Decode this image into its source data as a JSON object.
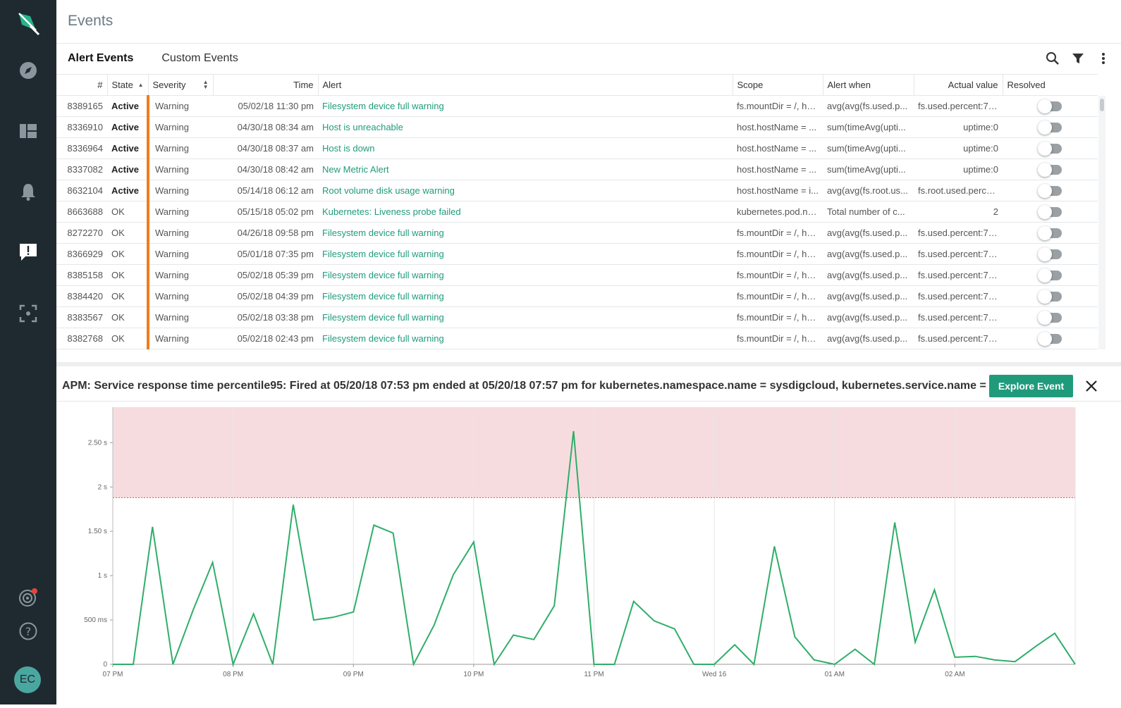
{
  "app": {
    "page_title": "Events"
  },
  "sidebar": {
    "icons": [
      "logo-icon",
      "explore-icon",
      "dashboards-icon",
      "alerts-icon",
      "events-icon",
      "capture-icon",
      "spotlight-icon",
      "help-icon"
    ],
    "avatar_initials": "EC"
  },
  "tabs": [
    {
      "label": "Alert Events"
    },
    {
      "label": "Custom Events"
    }
  ],
  "table": {
    "headers": [
      "#",
      "State",
      "Severity",
      "Time",
      "Alert",
      "Scope",
      "Alert when",
      "Actual value",
      "Resolved"
    ],
    "rows": [
      {
        "id": "8389165",
        "state": "Active",
        "severity": "Warning",
        "time": "05/02/18 11:30 pm",
        "alert": "Filesystem device full warning",
        "scope": "fs.mountDir = /, ho...",
        "alert_when": "avg(avg(fs.used.p...",
        "actual_value": "fs.used.percent:75..."
      },
      {
        "id": "8336910",
        "state": "Active",
        "severity": "Warning",
        "time": "04/30/18 08:34 am",
        "alert": "Host is unreachable",
        "scope": "host.hostName = ...",
        "alert_when": "sum(timeAvg(upti...",
        "actual_value": "uptime:0"
      },
      {
        "id": "8336964",
        "state": "Active",
        "severity": "Warning",
        "time": "04/30/18 08:37 am",
        "alert": "Host is down",
        "scope": "host.hostName = ...",
        "alert_when": "sum(timeAvg(upti...",
        "actual_value": "uptime:0"
      },
      {
        "id": "8337082",
        "state": "Active",
        "severity": "Warning",
        "time": "04/30/18 08:42 am",
        "alert": "New Metric Alert",
        "scope": "host.hostName = ...",
        "alert_when": "sum(timeAvg(upti...",
        "actual_value": "uptime:0"
      },
      {
        "id": "8632104",
        "state": "Active",
        "severity": "Warning",
        "time": "05/14/18 06:12 am",
        "alert": "Root volume disk usage warning",
        "scope": "host.hostName = i...",
        "alert_when": "avg(avg(fs.root.us...",
        "actual_value": "fs.root.used.perce..."
      },
      {
        "id": "8663688",
        "state": "OK",
        "severity": "Warning",
        "time": "05/15/18 05:02 pm",
        "alert": "Kubernetes: Liveness probe failed",
        "scope": "kubernetes.pod.na...",
        "alert_when": "Total number of c...",
        "actual_value": "2"
      },
      {
        "id": "8272270",
        "state": "OK",
        "severity": "Warning",
        "time": "04/26/18 09:58 pm",
        "alert": "Filesystem device full warning",
        "scope": "fs.mountDir = /, ho...",
        "alert_when": "avg(avg(fs.used.p...",
        "actual_value": "fs.used.percent:75..."
      },
      {
        "id": "8366929",
        "state": "OK",
        "severity": "Warning",
        "time": "05/01/18 07:35 pm",
        "alert": "Filesystem device full warning",
        "scope": "fs.mountDir = /, ho...",
        "alert_when": "avg(avg(fs.used.p...",
        "actual_value": "fs.used.percent:75..."
      },
      {
        "id": "8385158",
        "state": "OK",
        "severity": "Warning",
        "time": "05/02/18 05:39 pm",
        "alert": "Filesystem device full warning",
        "scope": "fs.mountDir = /, ho...",
        "alert_when": "avg(avg(fs.used.p...",
        "actual_value": "fs.used.percent:75..."
      },
      {
        "id": "8384420",
        "state": "OK",
        "severity": "Warning",
        "time": "05/02/18 04:39 pm",
        "alert": "Filesystem device full warning",
        "scope": "fs.mountDir = /, ho...",
        "alert_when": "avg(avg(fs.used.p...",
        "actual_value": "fs.used.percent:75..."
      },
      {
        "id": "8383567",
        "state": "OK",
        "severity": "Warning",
        "time": "05/02/18 03:38 pm",
        "alert": "Filesystem device full warning",
        "scope": "fs.mountDir = /, ho...",
        "alert_when": "avg(avg(fs.used.p...",
        "actual_value": "fs.used.percent:75..."
      },
      {
        "id": "8382768",
        "state": "OK",
        "severity": "Warning",
        "time": "05/02/18 02:43 pm",
        "alert": "Filesystem device full warning",
        "scope": "fs.mountDir = /, ho...",
        "alert_when": "avg(avg(fs.used.p...",
        "actual_value": "fs.used.percent:75..."
      }
    ],
    "severity_color": "#f07d1a",
    "link_color": "#1f9b7b"
  },
  "detail": {
    "title": "APM: Service response time percentile95: Fired at 05/20/18 07:53 pm ended at 05/20/18 07:57 pm for kubernetes.namespace.name = sysdigcloud, kubernetes.service.name = none",
    "explore_label": "Explore Event"
  },
  "chart_data": {
    "type": "line",
    "x_tick_labels": [
      "07 PM",
      "08 PM",
      "09 PM",
      "10 PM",
      "11 PM",
      "Wed 16",
      "01 AM",
      "02 AM"
    ],
    "y_tick_labels": [
      "0",
      "500 ms",
      "1 s",
      "1.50 s",
      "2 s",
      "2.50 s"
    ],
    "y_ticks": [
      0,
      0.5,
      1,
      1.5,
      2,
      2.5
    ],
    "ylim": [
      0,
      2.9
    ],
    "threshold": 1.88,
    "x_hours_from_7pm": [
      0,
      0.17,
      0.33,
      0.5,
      0.67,
      0.83,
      1.0,
      1.17,
      1.33,
      1.5,
      1.67,
      1.83,
      2.0,
      2.17,
      2.33,
      2.5,
      2.67,
      2.83,
      3.0,
      3.17,
      3.33,
      3.5,
      3.67,
      3.83,
      4.0,
      4.17,
      4.33,
      4.5,
      4.67,
      4.83,
      5.0,
      5.17,
      5.33,
      5.5,
      5.67,
      5.83,
      6.0,
      6.17,
      6.33,
      6.5,
      6.67,
      6.83,
      7.0,
      7.17,
      7.33,
      7.5,
      7.67,
      7.83,
      8.0
    ],
    "values": [
      0,
      0,
      1.55,
      0,
      0.62,
      1.15,
      0,
      0.57,
      0,
      1.8,
      0.5,
      0.53,
      0.59,
      1.57,
      1.48,
      0,
      0.44,
      1.01,
      1.38,
      0,
      0.33,
      0.28,
      0.66,
      2.63,
      0,
      0,
      0.71,
      0.49,
      0.4,
      0,
      0,
      0.22,
      0,
      1.33,
      0.31,
      0.05,
      0,
      0.17,
      0,
      1.6,
      0.25,
      0.84,
      0.08,
      0.09,
      0.05,
      0.03,
      0.2,
      0.35,
      0
    ],
    "line_color": "#2fae6a",
    "threshold_fill": "#f7dcdf"
  }
}
